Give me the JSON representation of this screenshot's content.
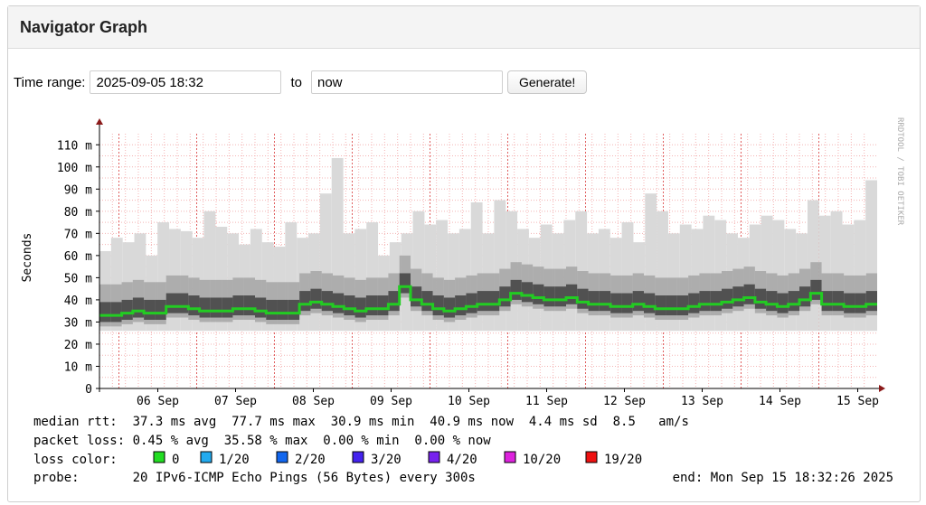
{
  "panel": {
    "title": "Navigator Graph"
  },
  "controls": {
    "time_range_label": "Time range:",
    "from_value": "2025-09-05 18:32",
    "to_label": "to",
    "to_value": "now",
    "generate_label": "Generate!"
  },
  "colors": {
    "grid": "#f4b3b3",
    "axis": "#8b1a1a",
    "shade_light": "#d9d9d9",
    "shade_dark": "#3a3a3a",
    "median": "#22cc22"
  },
  "chart_data": {
    "type": "line",
    "ylabel": "Seconds",
    "ylim": [
      0,
      115
    ],
    "y_ticks": [
      "0",
      "10 m",
      "20 m",
      "30 m",
      "40 m",
      "50 m",
      "60 m",
      "70 m",
      "80 m",
      "90 m",
      "100 m",
      "110 m"
    ],
    "x_ticks": [
      "06 Sep",
      "07 Sep",
      "08 Sep",
      "09 Sep",
      "10 Sep",
      "11 Sep",
      "12 Sep",
      "13 Sep",
      "14 Sep",
      "15 Sep"
    ],
    "watermark": "RRDTOOL / TOBI OETIKER",
    "series": [
      {
        "name": "median rtt",
        "color": "#22cc22",
        "values": [
          33,
          33,
          34,
          35,
          34,
          34,
          37,
          37,
          36,
          35,
          35,
          35,
          36,
          36,
          35,
          34,
          34,
          34,
          38,
          39,
          38,
          37,
          36,
          35,
          36,
          36,
          38,
          46,
          40,
          38,
          36,
          35,
          36,
          37,
          38,
          38,
          40,
          43,
          42,
          41,
          40,
          40,
          41,
          39,
          38,
          38,
          37,
          37,
          38,
          37,
          36,
          36,
          36,
          37,
          38,
          38,
          39,
          40,
          41,
          39,
          38,
          37,
          38,
          40,
          43,
          38,
          38,
          37,
          37,
          38
        ]
      }
    ],
    "spikes_max": [
      62,
      68,
      66,
      70,
      60,
      75,
      72,
      71,
      68,
      80,
      73,
      70,
      65,
      72,
      66,
      64,
      75,
      68,
      70,
      88,
      104,
      70,
      72,
      75,
      60,
      66,
      70,
      80,
      74,
      76,
      70,
      72,
      84,
      70,
      85,
      80,
      72,
      68,
      74,
      70,
      76,
      80,
      70,
      72,
      68,
      75,
      66,
      88,
      80,
      70,
      74,
      72,
      78,
      76,
      70,
      68,
      74,
      78,
      76,
      72,
      70,
      85,
      78,
      80,
      74,
      76,
      94
    ],
    "stats": [
      "median rtt:  37.3 ms avg  77.7 ms max  30.9 ms min  40.9 ms now  4.4 ms sd  8.5   am/s",
      "packet loss: 0.45 % avg  35.58 % max  0.00 % min  0.00 % now"
    ],
    "loss_color_label": "loss color:",
    "loss_legend": [
      {
        "label": "0",
        "color": "#22dd22"
      },
      {
        "label": "1/20",
        "color": "#22aaee"
      },
      {
        "label": "2/20",
        "color": "#1166ee"
      },
      {
        "label": "3/20",
        "color": "#4422ee"
      },
      {
        "label": "4/20",
        "color": "#7722ee"
      },
      {
        "label": "10/20",
        "color": "#dd22dd"
      },
      {
        "label": "19/20",
        "color": "#ee1111"
      }
    ],
    "probe_line": "probe:       20 IPv6-ICMP Echo Pings (56 Bytes) every 300s",
    "end_line": "end: Mon Sep 15 18:32:26 2025"
  }
}
